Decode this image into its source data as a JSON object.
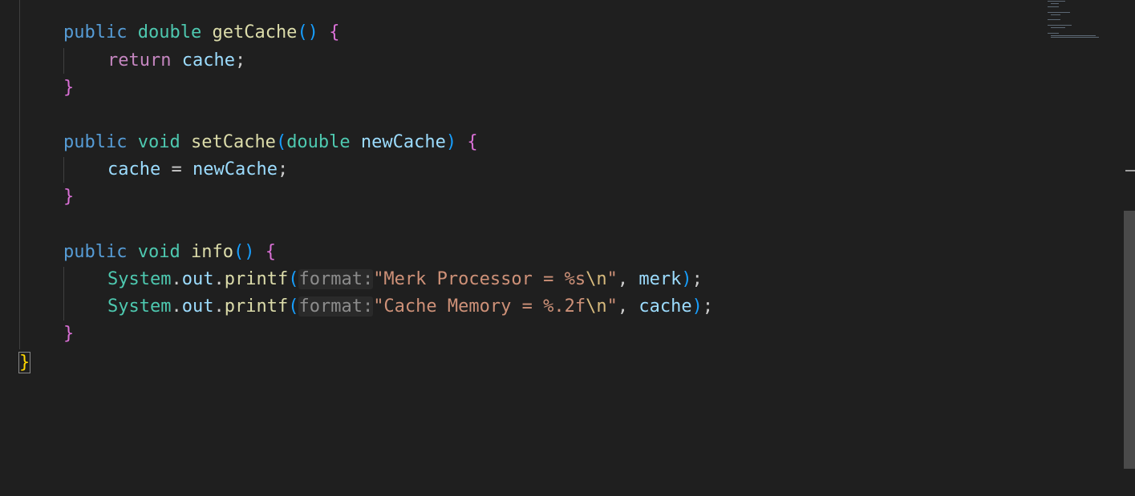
{
  "editor": {
    "lines": [
      {
        "tokens": [
          {
            "t": "public",
            "c": "kw"
          },
          {
            "t": " ",
            "c": "punc"
          },
          {
            "t": "double",
            "c": "type"
          },
          {
            "t": " ",
            "c": "punc"
          },
          {
            "t": "getCache",
            "c": "fn"
          },
          {
            "t": "()",
            "c": "br2"
          },
          {
            "t": " ",
            "c": "punc"
          },
          {
            "t": "{",
            "c": "br1"
          }
        ]
      },
      {
        "tokens": [
          {
            "t": "return",
            "c": "ctrl"
          },
          {
            "t": " ",
            "c": "punc"
          },
          {
            "t": "cache",
            "c": "var"
          },
          {
            "t": ";",
            "c": "punc"
          }
        ]
      },
      {
        "tokens": [
          {
            "t": "}",
            "c": "br1"
          }
        ]
      },
      {
        "tokens": []
      },
      {
        "tokens": [
          {
            "t": "public",
            "c": "kw"
          },
          {
            "t": " ",
            "c": "punc"
          },
          {
            "t": "void",
            "c": "type"
          },
          {
            "t": " ",
            "c": "punc"
          },
          {
            "t": "setCache",
            "c": "fn"
          },
          {
            "t": "(",
            "c": "br2"
          },
          {
            "t": "double",
            "c": "type"
          },
          {
            "t": " ",
            "c": "punc"
          },
          {
            "t": "newCache",
            "c": "var"
          },
          {
            "t": ")",
            "c": "br2"
          },
          {
            "t": " ",
            "c": "punc"
          },
          {
            "t": "{",
            "c": "br1"
          }
        ]
      },
      {
        "tokens": [
          {
            "t": "cache",
            "c": "var"
          },
          {
            "t": " = ",
            "c": "punc"
          },
          {
            "t": "newCache",
            "c": "var"
          },
          {
            "t": ";",
            "c": "punc"
          }
        ]
      },
      {
        "tokens": [
          {
            "t": "}",
            "c": "br1"
          }
        ]
      },
      {
        "tokens": []
      },
      {
        "tokens": [
          {
            "t": "public",
            "c": "kw"
          },
          {
            "t": " ",
            "c": "punc"
          },
          {
            "t": "void",
            "c": "type"
          },
          {
            "t": " ",
            "c": "punc"
          },
          {
            "t": "info",
            "c": "fn"
          },
          {
            "t": "()",
            "c": "br2"
          },
          {
            "t": " ",
            "c": "punc"
          },
          {
            "t": "{",
            "c": "br1"
          }
        ]
      },
      {
        "tokens": [
          {
            "t": "System",
            "c": "cls"
          },
          {
            "t": ".",
            "c": "punc"
          },
          {
            "t": "out",
            "c": "var"
          },
          {
            "t": ".",
            "c": "punc"
          },
          {
            "t": "printf",
            "c": "fn"
          },
          {
            "t": "(",
            "c": "br2"
          },
          {
            "t": "format:",
            "c": "hint"
          },
          {
            "t": "\"Merk Processor = %s",
            "c": "str"
          },
          {
            "t": "\\n",
            "c": "esc"
          },
          {
            "t": "\"",
            "c": "str"
          },
          {
            "t": ", ",
            "c": "punc"
          },
          {
            "t": "merk",
            "c": "var"
          },
          {
            "t": ")",
            "c": "br2"
          },
          {
            "t": ";",
            "c": "punc"
          }
        ]
      },
      {
        "tokens": [
          {
            "t": "System",
            "c": "cls"
          },
          {
            "t": ".",
            "c": "punc"
          },
          {
            "t": "out",
            "c": "var"
          },
          {
            "t": ".",
            "c": "punc"
          },
          {
            "t": "printf",
            "c": "fn"
          },
          {
            "t": "(",
            "c": "br2"
          },
          {
            "t": "format:",
            "c": "hint"
          },
          {
            "t": "\"Cache Memory = %.2f",
            "c": "str"
          },
          {
            "t": "\\n",
            "c": "esc"
          },
          {
            "t": "\"",
            "c": "str"
          },
          {
            "t": ", ",
            "c": "punc"
          },
          {
            "t": "cache",
            "c": "var"
          },
          {
            "t": ")",
            "c": "br2"
          },
          {
            "t": ";",
            "c": "punc"
          }
        ]
      },
      {
        "tokens": [
          {
            "t": "}",
            "c": "br1"
          }
        ]
      },
      {
        "tokens": [
          {
            "t": "}",
            "c": "br3"
          }
        ]
      }
    ]
  },
  "colors": {
    "background": "#1f1f1f",
    "keyword": "#569cd6",
    "type": "#4ec9b0",
    "function": "#dcdcaa",
    "control": "#c586c0",
    "variable": "#9cdcfe",
    "string": "#ce9178",
    "escape": "#d7ba7d",
    "bracket_level1": "#da70d6",
    "bracket_level2": "#179fff",
    "bracket_level3": "#ffd700",
    "inlay_hint": "#8c8c8c"
  }
}
